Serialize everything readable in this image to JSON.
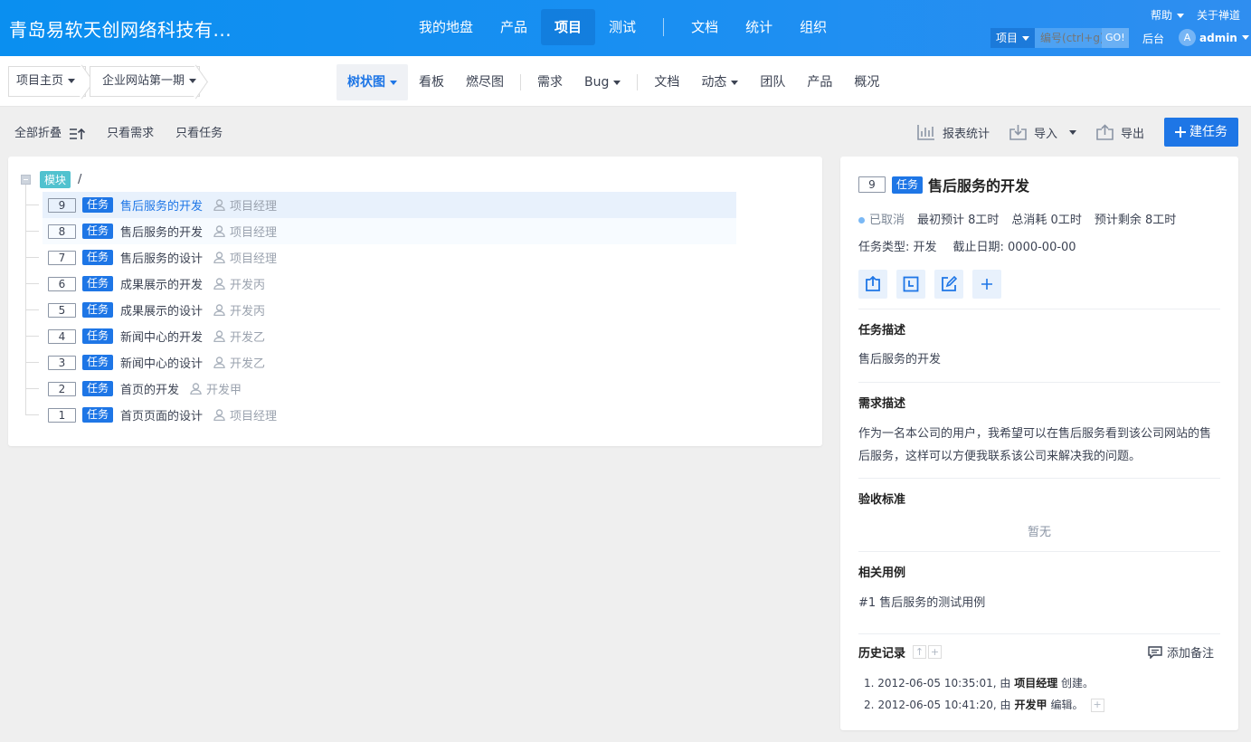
{
  "header": {
    "brand": "青岛易软天创网络科技有...",
    "nav": [
      "我的地盘",
      "产品",
      "项目",
      "测试",
      "文档",
      "统计",
      "组织"
    ],
    "active_nav": "项目",
    "help": "帮助",
    "about": "关于禅道",
    "search_select": "项目",
    "search_placeholder": "编号(ctrl+g)",
    "go": "GO!",
    "backend": "后台",
    "avatar_letter": "A",
    "user": "admin"
  },
  "subnav": {
    "crumb_home": "项目主页",
    "crumb_project": "企业网站第一期",
    "tabs": {
      "tree": "树状图",
      "kanban": "看板",
      "burndown": "燃尽图",
      "story": "需求",
      "bug": "Bug",
      "doc": "文档",
      "dynamic": "动态",
      "team": "团队",
      "product": "产品",
      "overview": "概况"
    }
  },
  "toolbar": {
    "collapse_all": "全部折叠",
    "only_story": "只看需求",
    "only_task": "只看任务",
    "report": "报表统计",
    "import": "导入",
    "export": "导出",
    "create_task": "建任务"
  },
  "tree": {
    "module_tag": "模块",
    "module_path": "/",
    "task_tag": "任务",
    "rows": [
      {
        "id": "9",
        "name": "售后服务的开发",
        "assignee": "项目经理"
      },
      {
        "id": "8",
        "name": "售后服务的开发",
        "assignee": "项目经理"
      },
      {
        "id": "7",
        "name": "售后服务的设计",
        "assignee": "项目经理"
      },
      {
        "id": "6",
        "name": "成果展示的开发",
        "assignee": "开发丙"
      },
      {
        "id": "5",
        "name": "成果展示的设计",
        "assignee": "开发丙"
      },
      {
        "id": "4",
        "name": "新闻中心的开发",
        "assignee": "开发乙"
      },
      {
        "id": "3",
        "name": "新闻中心的设计",
        "assignee": "开发乙"
      },
      {
        "id": "2",
        "name": "首页的开发",
        "assignee": "开发甲"
      },
      {
        "id": "1",
        "name": "首页页面的设计",
        "assignee": "项目经理"
      }
    ]
  },
  "detail": {
    "id": "9",
    "tag": "任务",
    "title": "售后服务的开发",
    "status": "已取消",
    "estimate": "最初预计 8工时",
    "consumed": "总消耗 0工时",
    "left": "预计剩余 8工时",
    "type": "任务类型: 开发",
    "deadline": "截止日期: 0000-00-00",
    "desc_title": "任务描述",
    "desc": "售后服务的开发",
    "story_title": "需求描述",
    "story": "作为一名本公司的用户，我希望可以在售后服务看到该公司网站的售后服务，这样可以方便我联系该公司来解决我的问题。",
    "verify_title": "验收标准",
    "verify": "暂无",
    "cases_title": "相关用例",
    "case": "#1 售后服务的测试用例",
    "history_title": "历史记录",
    "add_note": "添加备注",
    "history": [
      {
        "n": "1.",
        "time": "2012-06-05 10:35:01, 由",
        "actor": "项目经理",
        "action": "创建。"
      },
      {
        "n": "2.",
        "time": "2012-06-05 10:41:20, 由",
        "actor": "开发甲",
        "action": "编辑。"
      }
    ]
  },
  "colors": {
    "primary": "#1e76e6",
    "header": "#1c8ff2",
    "module_tag": "#51c2cf"
  }
}
